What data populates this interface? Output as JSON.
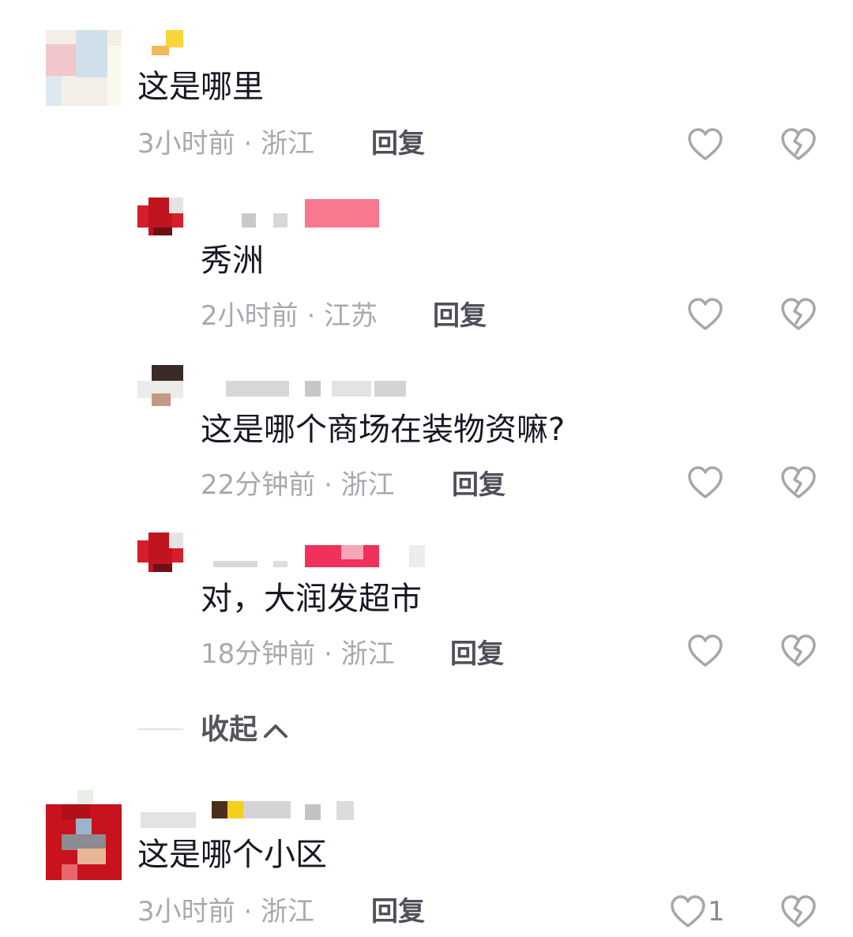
{
  "comments": [
    {
      "content": "这是哪里",
      "meta": "3小时前 · 浙江",
      "reply_label": "回复",
      "replies": [
        {
          "content": "秀洲",
          "meta": "2小时前 · 江苏",
          "reply_label": "回复"
        },
        {
          "content": "这是哪个商场在装物资嘛?",
          "meta": "22分钟前 · 浙江",
          "reply_label": "回复"
        },
        {
          "content": "对，大润发超市",
          "meta": "18分钟前 · 浙江",
          "reply_label": "回复"
        }
      ],
      "collapse_label": "收起"
    },
    {
      "content": "这是哪个小区",
      "meta": "3小时前 · 浙江",
      "reply_label": "回复",
      "like_count": "1"
    }
  ],
  "icons": {
    "like": "heart-outline-icon",
    "dislike": "broken-heart-icon",
    "collapse": "chevron-up-icon"
  },
  "colors": {
    "text_primary": "#161823",
    "text_meta": "#a8a9ae",
    "icon": "#a6a7ab"
  }
}
